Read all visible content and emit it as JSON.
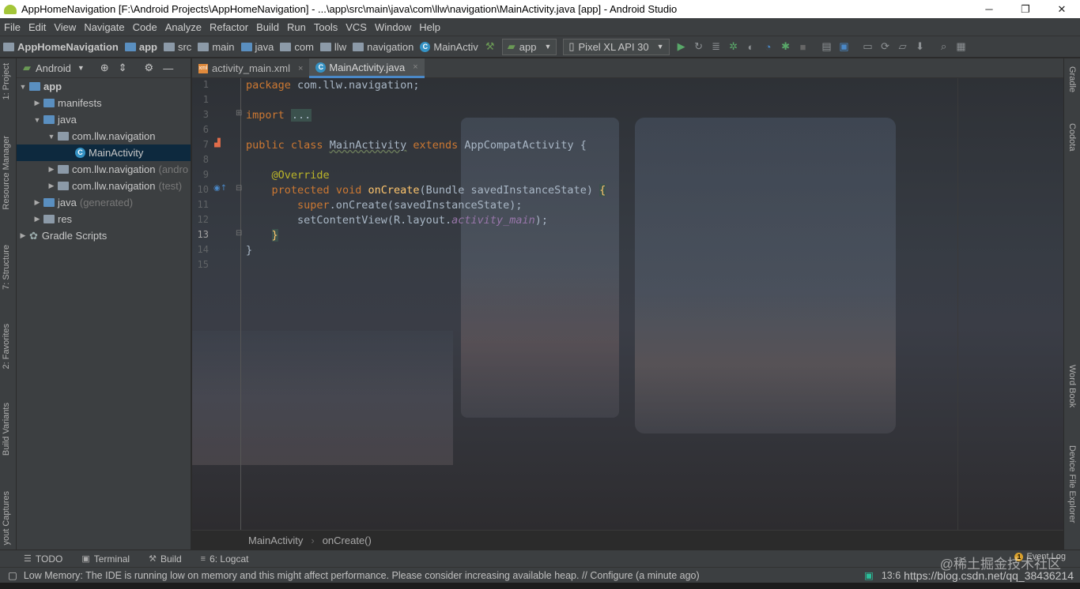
{
  "window": {
    "title": "AppHomeNavigation [F:\\Android Projects\\AppHomeNavigation] - ...\\app\\src\\main\\java\\com\\llw\\navigation\\MainActivity.java [app] - Android Studio",
    "minimize": "─",
    "maximize": "❐",
    "close": "✕"
  },
  "menu": [
    "File",
    "Edit",
    "View",
    "Navigate",
    "Code",
    "Analyze",
    "Refactor",
    "Build",
    "Run",
    "Tools",
    "VCS",
    "Window",
    "Help"
  ],
  "breadcrumbs": [
    "AppHomeNavigation",
    "app",
    "src",
    "main",
    "java",
    "com",
    "llw",
    "navigation",
    "MainActiv"
  ],
  "toolbar": {
    "run_config": "app",
    "device": "Pixel XL API 30"
  },
  "left_tabs": {
    "project": "1: Project",
    "resource_manager": "Resource Manager",
    "structure": "7: Structure",
    "favorites": "2: Favorites",
    "build_variants": "Build Variants",
    "layout_captures": "yout Captures"
  },
  "right_tabs": {
    "gradle": "Gradle",
    "codota": "Codota",
    "word_book": "Word Book",
    "device_file_explorer": "Device File Explorer"
  },
  "project_panel": {
    "view_mode": "Android",
    "tree": [
      {
        "label": "app",
        "dim": ""
      },
      {
        "label": "manifests",
        "dim": ""
      },
      {
        "label": "java",
        "dim": ""
      },
      {
        "label": "com.llw.navigation",
        "dim": ""
      },
      {
        "label": "MainActivity",
        "dim": ""
      },
      {
        "label": "com.llw.navigation",
        "dim": "(andro"
      },
      {
        "label": "com.llw.navigation",
        "dim": "(test)"
      },
      {
        "label": "java",
        "dim": "(generated)"
      },
      {
        "label": "res",
        "dim": ""
      },
      {
        "label": "Gradle Scripts",
        "dim": ""
      }
    ]
  },
  "editor_tabs": [
    {
      "label": "activity_main.xml",
      "close": "×"
    },
    {
      "label": "MainActivity.java",
      "close": "×"
    }
  ],
  "line_numbers": [
    "1",
    "2",
    "3",
    "6",
    "7",
    "8",
    "9",
    "10",
    "11",
    "12",
    "13",
    "14",
    "15"
  ],
  "code": {
    "l1_kw": "package",
    "l1_rest": " com.llw.navigation;",
    "l3_kw": "import",
    "l3_fold": "...",
    "l7_kw1": "public",
    "l7_kw2": "class",
    "l7_name": "MainActivity",
    "l7_kw3": "extends",
    "l7_rest": " AppCompatActivity {",
    "l9_ann": "@Override",
    "l10_kw1": "protected",
    "l10_kw2": "void",
    "l10_fn": "onCreate",
    "l10_rest": "(Bundle savedInstanceState) ",
    "l10_brace": "{",
    "l11_kw": "super",
    "l11_rest": ".onCreate(savedInstanceState);",
    "l12_a": "setContentView(R.layout.",
    "l12_it": "activity_main",
    "l12_b": ");",
    "l13": "}",
    "l14": "}"
  },
  "editor_breadcrumb": [
    "MainActivity",
    "onCreate()"
  ],
  "tool_windows": [
    {
      "label": "TODO",
      "icon": "☰"
    },
    {
      "label": "Terminal",
      "icon": "▣"
    },
    {
      "label": "Build",
      "icon": "⚒"
    },
    {
      "label": "6: Logcat",
      "icon": "≡"
    }
  ],
  "event_log": {
    "badge": "1",
    "label": "Event Log"
  },
  "status": {
    "message": "Low Memory: The IDE is running low on memory and this might affect performance. Please consider increasing available heap. // Configure (a minute ago)",
    "position": "13:6",
    "watermark": "https://blog.csdn.net/qq_38436214",
    "watermark2": "@稀土掘金技术社区"
  },
  "colors": {
    "keyword": "#cc7832",
    "annotation": "#bbb529",
    "function": "#ffc66d",
    "field": "#9876aa",
    "text": "#a9b7c6",
    "selection": "#0d293e"
  }
}
